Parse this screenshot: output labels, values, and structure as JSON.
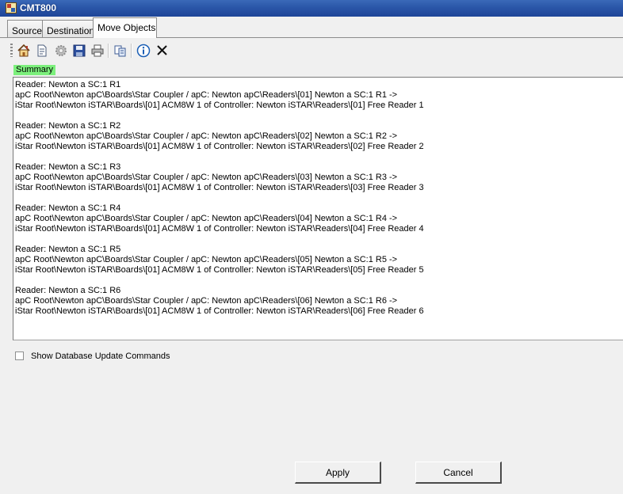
{
  "window": {
    "title": "CMT800"
  },
  "tabs": [
    {
      "label": "Source"
    },
    {
      "label": "Destination"
    },
    {
      "label": "Move Objects",
      "active": true
    }
  ],
  "toolbar": {
    "icons": [
      "home-icon",
      "document-icon",
      "settings-icon",
      "save-icon",
      "print-icon",
      "copy-icon",
      "info-icon",
      "close-icon"
    ]
  },
  "summary": {
    "label": "Summary",
    "highlight_color": "#7cf07c",
    "entries": [
      {
        "header": "Reader: Newton a SC:1 R1",
        "source": "apC Root\\Newton apC\\Boards\\Star Coupler / apC: Newton apC\\Readers\\[01] Newton a SC:1 R1 ->",
        "destination": "iStar Root\\Newton iSTAR\\Boards\\[01] ACM8W 1 of Controller: Newton iSTAR\\Readers\\[01]  Free Reader 1"
      },
      {
        "header": "Reader: Newton a SC:1 R2",
        "source": "apC Root\\Newton apC\\Boards\\Star Coupler / apC: Newton apC\\Readers\\[02] Newton a SC:1 R2 ->",
        "destination": "iStar Root\\Newton iSTAR\\Boards\\[01] ACM8W 1 of Controller: Newton iSTAR\\Readers\\[02]  Free Reader 2"
      },
      {
        "header": "Reader: Newton a SC:1 R3",
        "source": "apC Root\\Newton apC\\Boards\\Star Coupler / apC: Newton apC\\Readers\\[03] Newton a SC:1 R3 ->",
        "destination": "iStar Root\\Newton iSTAR\\Boards\\[01] ACM8W 1 of Controller: Newton iSTAR\\Readers\\[03]  Free Reader 3"
      },
      {
        "header": "Reader: Newton a SC:1 R4",
        "source": "apC Root\\Newton apC\\Boards\\Star Coupler / apC: Newton apC\\Readers\\[04] Newton a SC:1 R4 ->",
        "destination": "iStar Root\\Newton iSTAR\\Boards\\[01] ACM8W 1 of Controller: Newton iSTAR\\Readers\\[04]  Free Reader 4"
      },
      {
        "header": "Reader: Newton a SC:1 R5",
        "source": "apC Root\\Newton apC\\Boards\\Star Coupler / apC: Newton apC\\Readers\\[05] Newton a SC:1 R5 ->",
        "destination": "iStar Root\\Newton iSTAR\\Boards\\[01] ACM8W 1 of Controller: Newton iSTAR\\Readers\\[05]  Free Reader 5"
      },
      {
        "header": "Reader: Newton a SC:1 R6",
        "source": "apC Root\\Newton apC\\Boards\\Star Coupler / apC: Newton apC\\Readers\\[06] Newton a SC:1 R6 ->",
        "destination": "iStar Root\\Newton iSTAR\\Boards\\[01] ACM8W 1 of Controller: Newton iSTAR\\Readers\\[06]  Free Reader 6"
      }
    ]
  },
  "options": {
    "show_db_commands_label": "Show Database Update Commands",
    "show_db_commands_checked": false
  },
  "buttons": {
    "apply": "Apply",
    "cancel": "Cancel"
  }
}
